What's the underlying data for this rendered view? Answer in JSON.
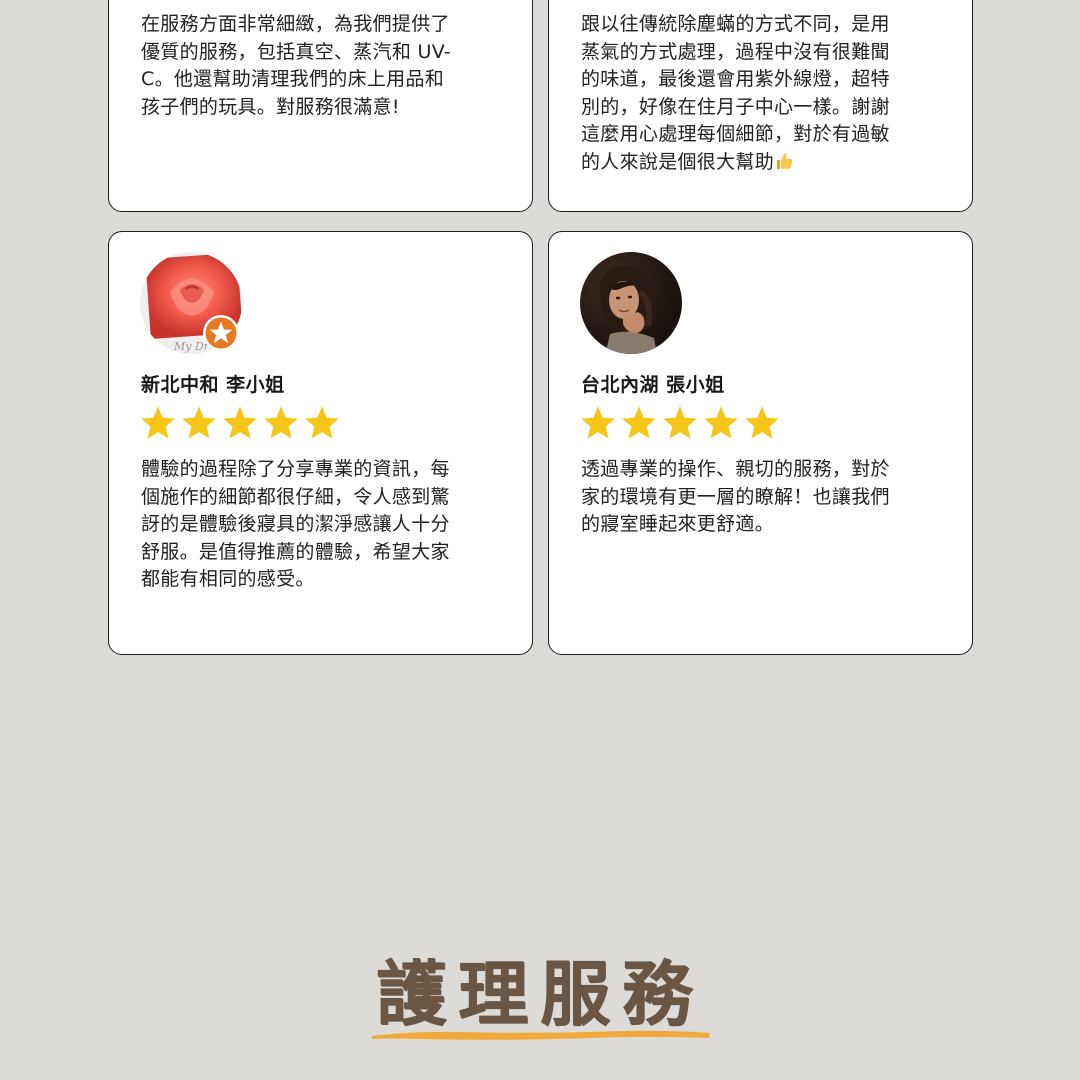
{
  "reviews": [
    {
      "id": "top-left",
      "text": "在服務方面非常細緻，為我們提供了\n優質的服務，包括真空、蒸汽和 UV-\nC。他還幫助清理我們的床上用品和\n孩子們的玩具。對服務很滿意!"
    },
    {
      "id": "top-right",
      "text": "跟以往傳統除塵蟎的方式不同，是用\n蒸氣的方式處理，過程中沒有很難聞\n的味道，最後還會用紫外線燈，超特\n別的，好像在住月子中心一樣。謝謝\n這麼用心處理每個細節，對於有過敏\n的人來說是個很大幫助",
      "emoji": "thumbs-up-icon"
    },
    {
      "id": "bottom-left",
      "name": "新北中和 李小姐",
      "rating": 5,
      "text": "體驗的過程除了分享專業的資訊，每\n個施作的細節都很仔細，令人感到驚\n訝的是體驗後寢具的潔淨感讓人十分\n舒服。是值得推薦的體驗，希望大家\n都能有相同的感受。",
      "avatar": "rose-photo-avatar"
    },
    {
      "id": "bottom-right",
      "name": "台北內湖 張小姐",
      "rating": 5,
      "text": "透過專業的操作、親切的服務，對於\n家的環境有更一層的瞭解！也讓我們\n的寢室睡起來更舒適。",
      "avatar": "woman-portrait-avatar"
    }
  ],
  "section": {
    "title": "護理服務"
  },
  "colors": {
    "background": "#dcdbd8",
    "star": "#f5c518",
    "title": "#6b5644",
    "underline": "#f2a93b",
    "badge": "#e87722"
  }
}
